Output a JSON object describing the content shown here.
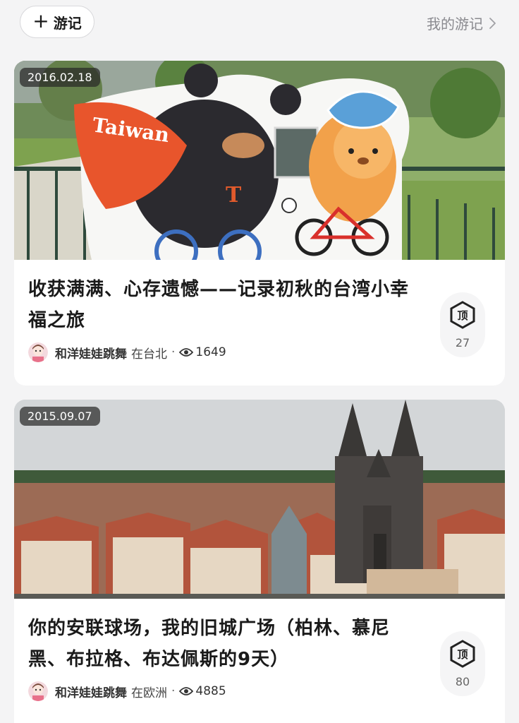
{
  "topbar": {
    "new_label": "游记",
    "my_label": "我的游记"
  },
  "posts": [
    {
      "date": "2016.02.18",
      "title": "收获满满、心存遗憾——记录初秋的台湾小幸福之旅",
      "author": "和洋娃娃跳舞",
      "location": "在台北",
      "views": "1649",
      "likes": "27",
      "cutout_text": "Taiwan",
      "photo_desc": "bear-and-cyclist-cutout"
    },
    {
      "date": "2015.09.07",
      "title": "你的安联球场，我的旧城广场（柏林、慕尼黑、布拉格、布达佩斯的9天）",
      "author": "和洋娃娃跳舞",
      "location": "在欧洲",
      "views": "4885",
      "likes": "80",
      "photo_desc": "prague-old-town-skyline"
    }
  ],
  "like_icon_text": "顶",
  "colors": {
    "background": "#f4f4f5",
    "card": "#ffffff",
    "badge": "#3a3a3a",
    "muted": "#8a8a8f"
  }
}
